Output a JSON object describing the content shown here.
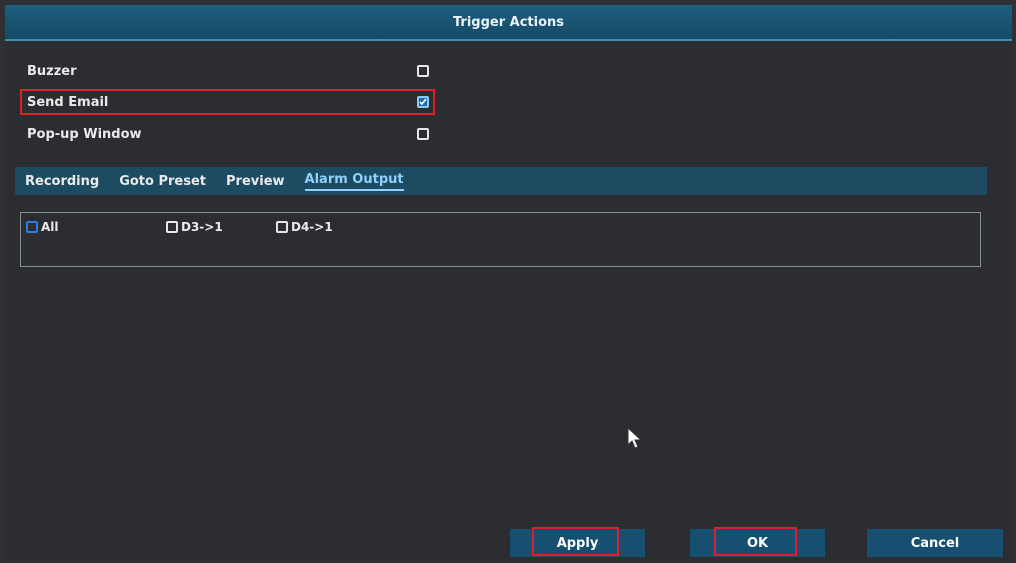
{
  "window": {
    "title": "Trigger Actions"
  },
  "actions": [
    {
      "label": "Buzzer",
      "checked": false
    },
    {
      "label": "Send Email",
      "checked": true
    },
    {
      "label": "Pop-up Window",
      "checked": false
    }
  ],
  "tabs": [
    {
      "label": "Recording"
    },
    {
      "label": "Goto Preset"
    },
    {
      "label": "Preview"
    },
    {
      "label": "Alarm Output",
      "active": true
    }
  ],
  "alarm_outputs": [
    {
      "label": "All",
      "checked": false
    },
    {
      "label": "D3->1",
      "checked": false
    },
    {
      "label": "D4->1",
      "checked": false
    }
  ],
  "buttons": {
    "apply": "Apply",
    "ok": "OK",
    "cancel": "Cancel"
  },
  "colors": {
    "title_bar": "#1d5f7f",
    "highlight": "#e01e2a",
    "button": "#164f70",
    "active_tab": "#8ed1ff"
  }
}
